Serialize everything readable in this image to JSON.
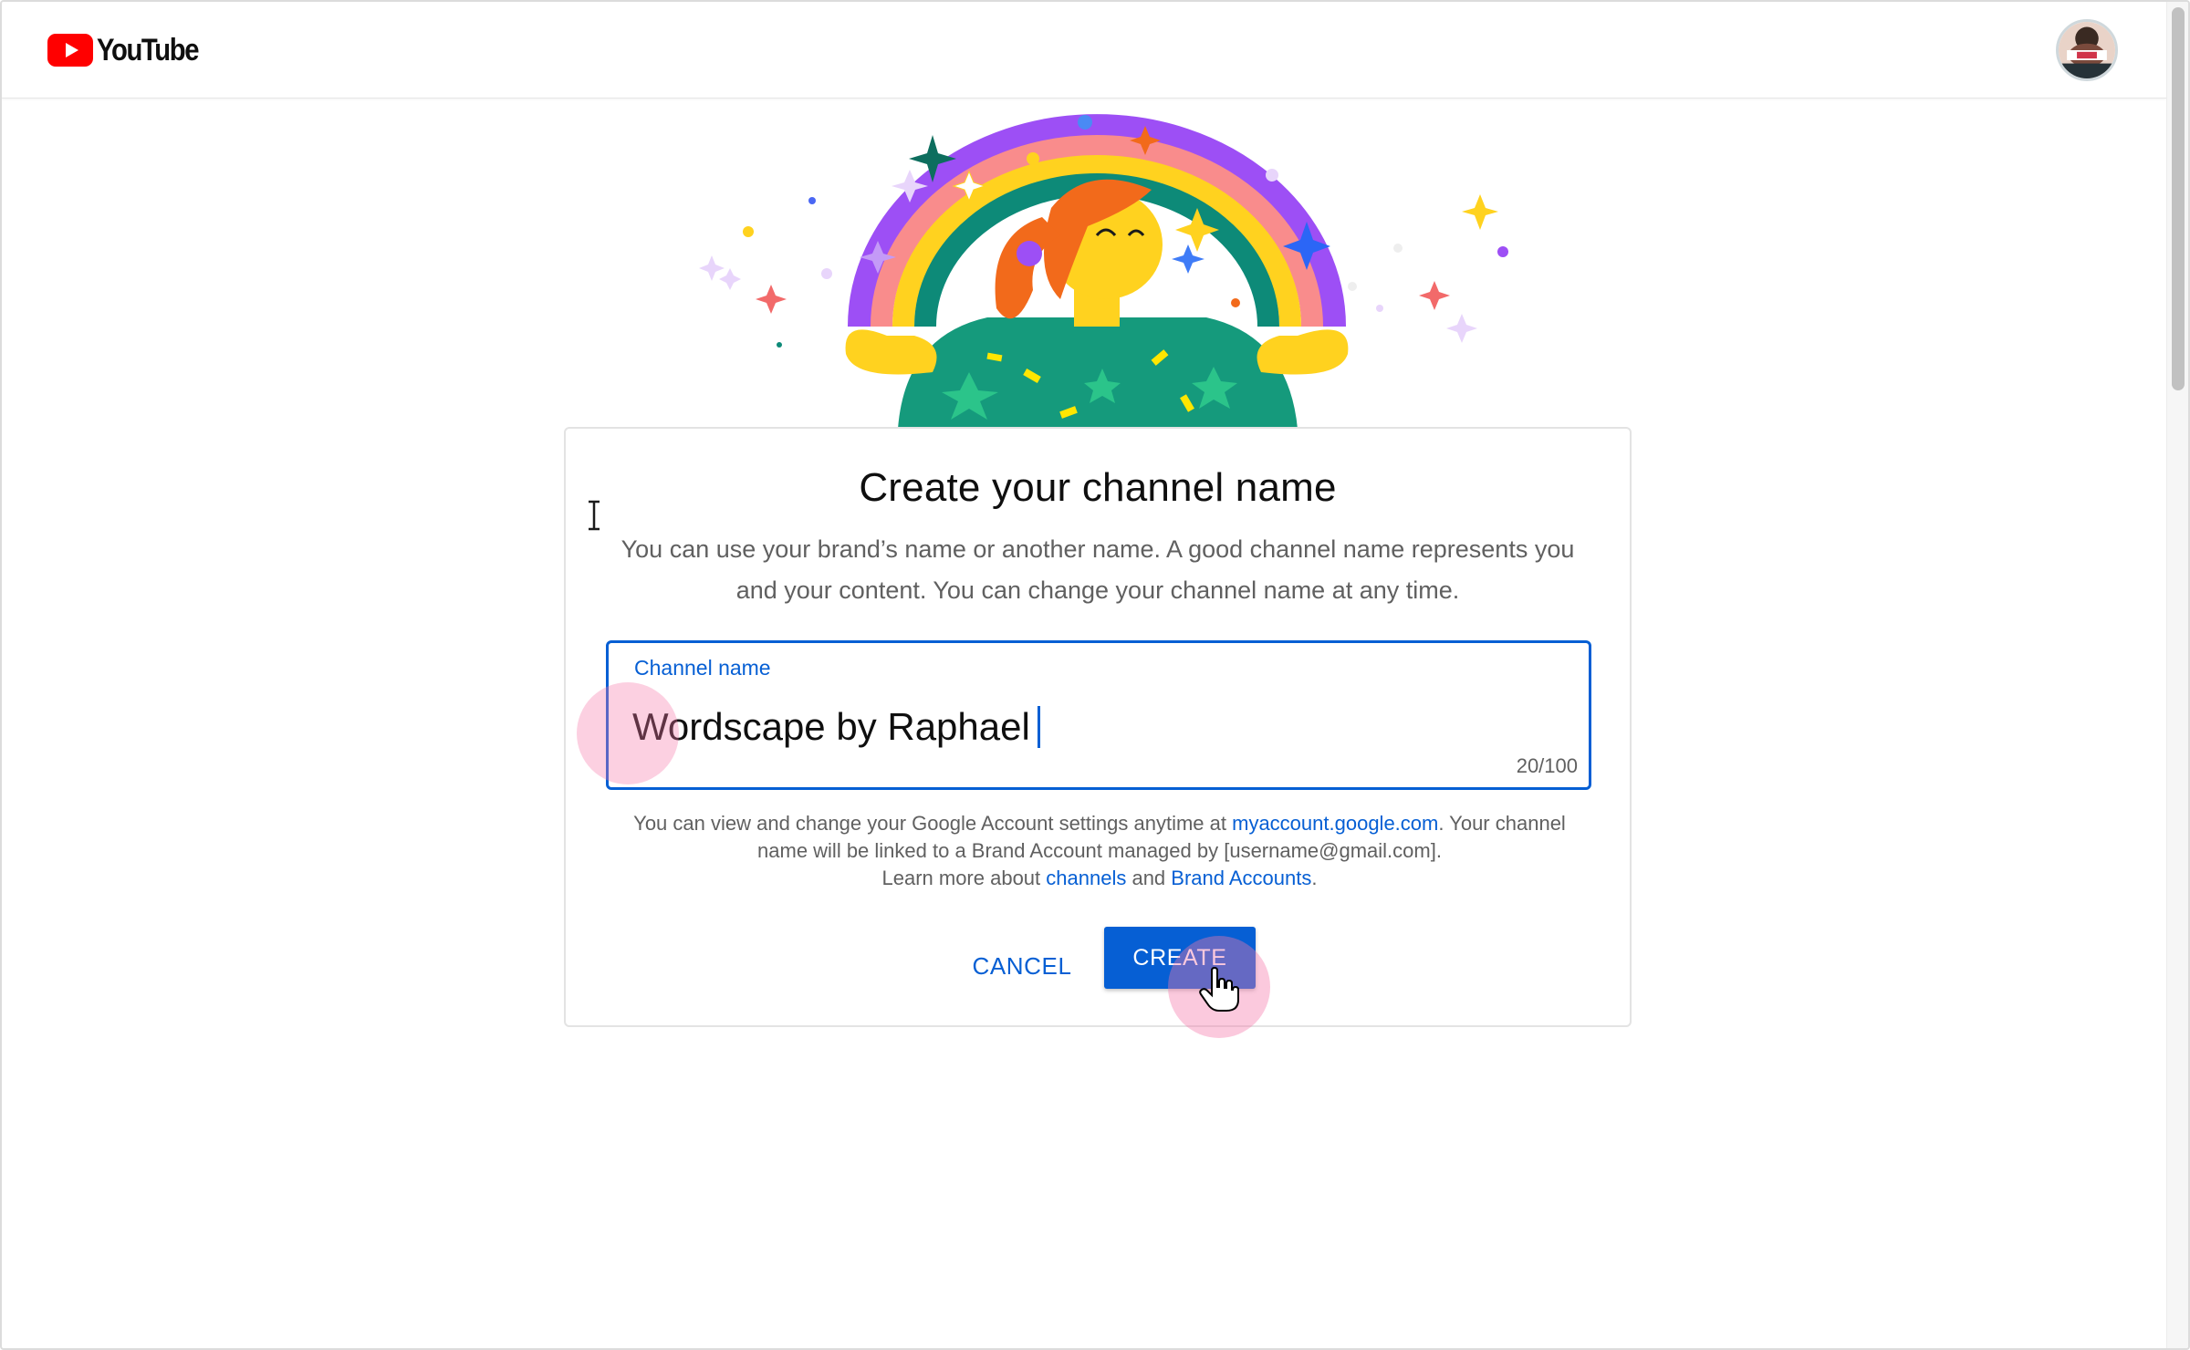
{
  "header": {
    "logo_text": "YouTube",
    "logo_icon": "youtube-play-icon",
    "brand_color": "#FF0000",
    "avatar_icon": "avatar"
  },
  "card": {
    "title": "Create your channel name",
    "description": "You can use your brand’s name or another name. A good channel name represents you and your content. You can change your channel name at any time.",
    "field": {
      "label": "Channel name",
      "value": "Wordscape by Raphael",
      "counter": "20/100",
      "accent_color": "#065FD4"
    },
    "note": {
      "text_1": "You can view and change your Google Account settings anytime at ",
      "link_account": "myaccount.google.com",
      "text_2": ". Your channel name will be linked to a Brand Account managed by [username@gmail.com].",
      "text_3": "Learn more about ",
      "link_channels": "channels",
      "text_4": " and ",
      "link_brand": "Brand Accounts",
      "text_5": "."
    },
    "buttons": {
      "cancel": "CANCEL",
      "create": "CREATE"
    }
  },
  "overlay": {
    "click_highlight_color": "#F678AA"
  }
}
